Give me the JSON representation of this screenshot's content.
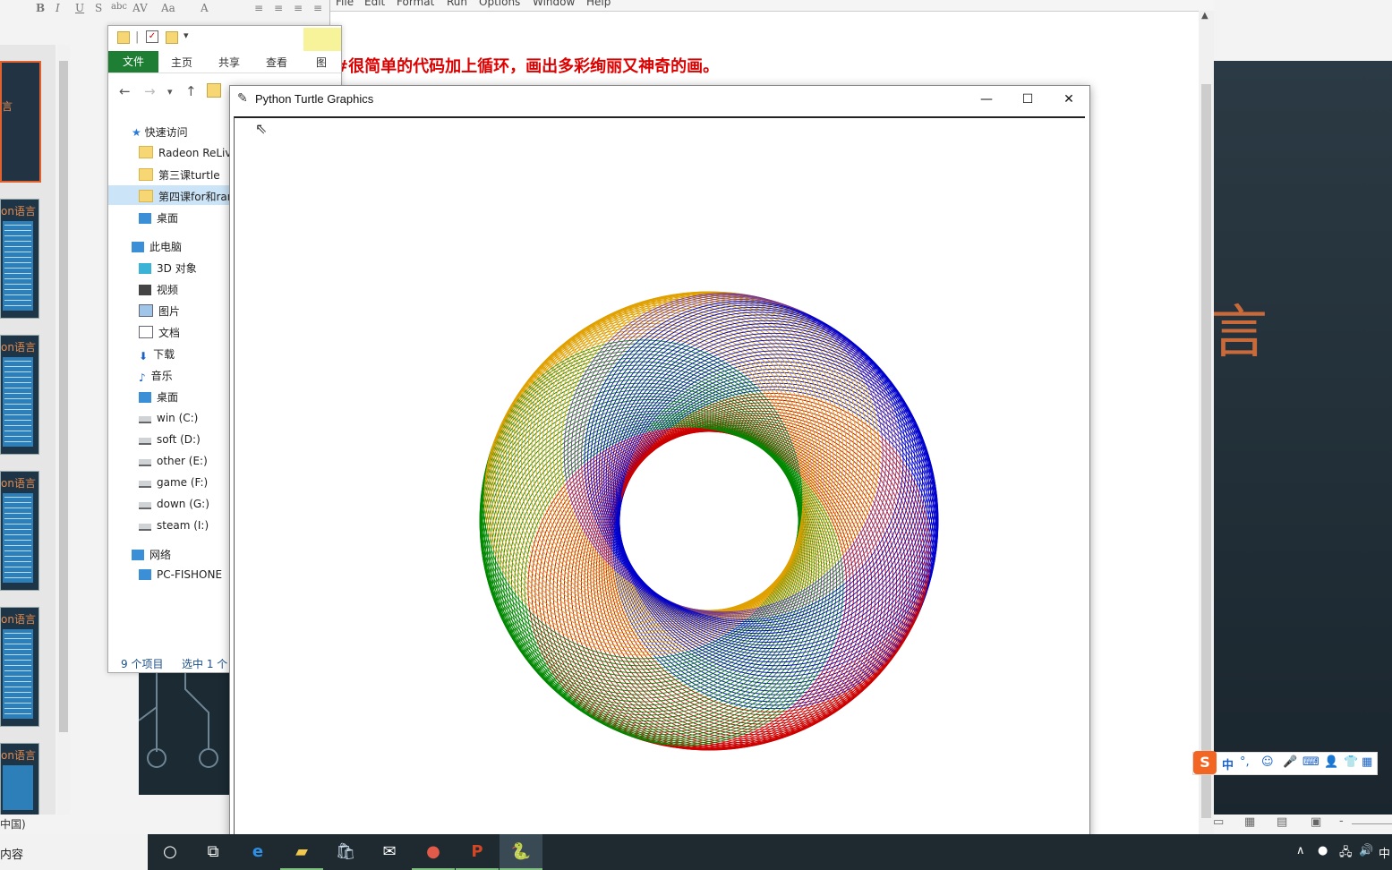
{
  "editor": {
    "menu": [
      "File",
      "Edit",
      "Format",
      "Run",
      "Options",
      "Window",
      "Help"
    ],
    "code_comment": "#很简单的代码加上循环，画出多彩绚丽又神奇的画。"
  },
  "explorer": {
    "tabs": [
      "文件",
      "主页",
      "共享",
      "查看",
      "图"
    ],
    "quick_access": "快速访问",
    "items": [
      "Radeon ReLive",
      "第三课turtle",
      "第四课for和ran",
      "桌面"
    ],
    "this_pc": "此电脑",
    "pc_items": [
      "3D 对象",
      "视频",
      "图片",
      "文档",
      "下载",
      "音乐",
      "桌面"
    ],
    "drives": [
      "win (C:)",
      "soft (D:)",
      "other (E:)",
      "game (F:)",
      "down (G:)",
      "steam (I:)"
    ],
    "network": "网络",
    "network_items": [
      "PC-FISHONE"
    ],
    "status_count": "9 个项目",
    "status_selected": "选中 1 个"
  },
  "turtle": {
    "title": "Python Turtle Graphics",
    "minimize": "—",
    "maximize": "☐",
    "close": "✕"
  },
  "drawing": {
    "colors": [
      "#0000cc",
      "#cc0000",
      "#008800",
      "#e0a000",
      "#7a3b8c"
    ],
    "center_label": ""
  },
  "ppt": {
    "status_left": "中国)",
    "thumb_title": "on语言",
    "slide_glyph": "言"
  },
  "ime": {
    "logo": "S",
    "mode": "中"
  },
  "taskbar": {
    "search_text": "内容",
    "ime_indicator": "中"
  }
}
